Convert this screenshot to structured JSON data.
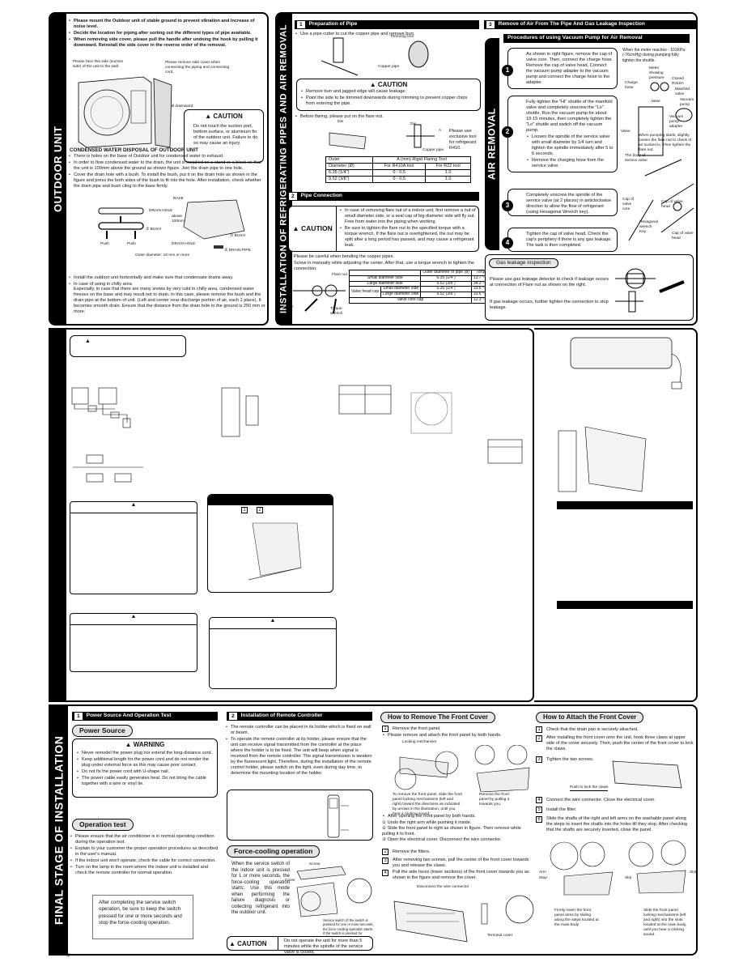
{
  "outdoor": {
    "band": "OUTDOOR UNIT",
    "bullets": [
      "Please mount the Outdoor unit of stable ground to prevent vibration and increase of noise level.",
      "Decide the location for piping after sorting out the different types of pipe available.",
      "When removing side cover, please pull the handle after undoing the hook by pulling it downward. Reinstall the side cover in the reverse order of the removal."
    ],
    "fig_labels": {
      "face": "Please face this side (suction side) of the unit to the wall.",
      "remove": "Please remove side cover when connecting the piping and connecting cord.",
      "pull": "Pull downward"
    },
    "caution": {
      "title": "▲ CAUTION",
      "text": "Do not touch the suction port, bottom surface, or aluminum fin of the outdoor unit. Failure to do so may cause an injury."
    },
    "condensed_title": "CONDENSED WATER DISPOSAL OF OUTDOOR UNIT",
    "condensed_bullets": [
      "There is holes on the base of Outdoor unit for condensed water to exhaust.",
      "In order to flow condensed water to the drain, the unit is installed on a stand or a block so that the unit is 100mm above the ground as shown figure. Join the drain pipe to one hole.",
      "Cover the drain hole with a bush. To install the bush, put it on the drain hole as shown in the figure and press the both sides of the bush to fit into the hole. After installation, check whether the drain pipe and bush cling to the base firmly."
    ],
    "drain_labels": {
      "drain_hole": "DRAIN HOLE",
      "bush": "① BUSH",
      "push1": "Push",
      "push2": "Push",
      "base": "BASE",
      "above": "above 100mm",
      "drain_hole2": "DRAIN HOLE",
      "bush2": "① BUSH",
      "drain_pipe": "② DRAIN PIPE",
      "outer": "Outer diameter: 16 mm or more"
    },
    "final_bullets": [
      "Install the outdoor unit horizontally and make sure that condensate drains away.",
      "In case of using in chilly area"
    ],
    "chilly_text": "Especially, in case that there are many snows by very cold in chilly area, condensed water freezes on the base and may result not to drain. In this case, please remove the bush and the drain pipe at the bottom of unit. (Left and center near discharge portion of air, each 1 place). It becomes smooth drain. Ensure that the distance from the drain hole to the ground is 250 mm or more."
  },
  "install": {
    "band": "INSTALLATION OF REFRIGERATING PIPES AND AIR REMOVAL",
    "s1": {
      "num": "1",
      "title": "Preparation of Pipe",
      "bullet": "Use a pipe cutter to cut the copper pipe and remove burr.",
      "trim": "Trimming tool",
      "copper": "Copper pipe",
      "caution_title": "▲ CAUTION",
      "caution": [
        "Remove burr and jagged edge will cause leakage.",
        "Point the side to be trimmed downwards during trimming to prevent copper chips from entering the pipe."
      ],
      "flare_bullet": "Before flaring, please put on the flare nut.",
      "die1": "Die",
      "die2": "Die",
      "a": "A",
      "copper2": "Copper pipe",
      "note": "Please use exclusive tool for refrigerant R410.",
      "table": {
        "h1": "Outer",
        "h1b": "Diameter (Ø)",
        "h2": "A (mm) Rigid Flaring Tool",
        "h3": "For R410A tool",
        "h4": "For R22 tool",
        "rows": [
          [
            "6.35 (1/4\")",
            "0 - 0.5",
            "1.0"
          ],
          [
            "9.52 (3/8\")",
            "0 - 0.5",
            "1.0"
          ]
        ]
      }
    },
    "s2": {
      "num": "2",
      "title": "Pipe Connection",
      "caution_title": "▲ CAUTION",
      "caution": [
        "In case of removing flare nut of a indoor unit, first remove a nut of small diameter side, or a seal cap of big diameter side will fly out. Free from water into the piping when working.",
        "Be sure to tighten the flare nut to the specified torque with a torque wrench. If the flare nut is overtightened, the nut may be split after a long period has passed, and may cause a refrigerant leak."
      ],
      "bullets": [
        "Please be careful when bending the copper pipes.",
        "Screw in manually while adjusting the center. After that, use a torque wrench to tighten the connection."
      ],
      "flare": "Flare nut",
      "wrench": "Wrench",
      "torque": "Torque wrench",
      "table": {
        "h1": "Outer diameter of pipe (ø)",
        "h2": "Torque N m (kgf-cm)",
        "rows": [
          [
            "Small diameter side",
            "6.35 (1/4\")",
            "13.7 ~ 18.6 (140 ~ 190)"
          ],
          [
            "Large diameter side",
            "9.52 (3/8\")",
            "34.3 ~ 44.1 (350 ~ 450)"
          ]
        ],
        "valve": "Valve head cap",
        "vrows": [
          [
            "Small diameter side",
            "6.35 (1/4\")",
            "19.6 ~ 24.5 (200 ~ 250)"
          ],
          [
            "Large diameter side",
            "9.52 (3/8\")",
            "19.6 ~ 24.5 (200 ~ 250)"
          ]
        ],
        "core": "Valve core cap",
        "core_val": "12.3 ~ 15.7 (125 ~ 160)"
      }
    },
    "s3": {
      "num": "3",
      "title": "Remove of Air From The Pipe And Gas Leakage Inspection",
      "sub": "Procedures of using Vacuum Pump for Air Removal",
      "band": "AIR REMOVAL",
      "steps": [
        "As shown in right figure, remove the cap of valve core. Then, connect the charge hose. Remove the cap of valve head. Connect the vacuum pump adapter to the vacuum pump and connect the charge hose to the adapter.",
        "Fully tighten the \"Hi\" shuttle of the manifold valve and completely unscrew the \"Lo\" shuttle. Run the vacuum pump for about 10-15 minutes, then completely tighten the \"Lo\" shuttle and switch off the vacuum pump.",
        "Completely unscrew the spindle of the service valve (at 2 places) in anticlockwise direction to allow the flow of refrigerant (using Hexagonal Wrench key).",
        "Tighten the cap of valve head. Check the cap's periphery if there is any gas leakage. The task is then completed."
      ],
      "step2_sub": [
        "Loosen the spindle of the service valve with small diameter by 1/4 turn and tighten the spindle immediately after 5 to 6 seconds.",
        "Remove the charging hose from the service valve."
      ],
      "fig": {
        "meter_note": "When the meter reaches - 101KPa (-76cmHg) during pumping fully tighten the shuttle.",
        "meter": "Meter showing pressure",
        "closed": "Closed R410A",
        "manifold": "Manifold valve",
        "charge": "Charge hose",
        "valve": "Valve",
        "vacuum": "Vacuum pump",
        "adapter": "Vacuum pump adapter",
        "valve2": "Valve",
        "pumping": "When pumping starts, slightly loosen the flare nut to check of air sucked in. Then tighten the flare nut.",
        "body": "The body of service valve",
        "capcore": "Cap of valve core",
        "hex": "Hexagonal wrench Key",
        "caphead": "Cap of valve head",
        "caphead2": "Cap of valve head"
      },
      "gas_title": "Gas leakage inspection",
      "gas_p1": "Please use gas leakage detector to check if leakage occurs at connection of Flare nut as shown on the right.",
      "gas_p2": "If gas leakage occurs, further tighten the connection to stop leakage."
    }
  },
  "middle": {
    "caution_icon": "▲",
    "box_numbers": [
      "1",
      "2"
    ]
  },
  "final": {
    "band": "FINAL STAGE OF INSTALLATION",
    "s1": {
      "num": "1",
      "title": "Power Source And Operation Test",
      "power": "Power Source",
      "warning": "▲ WARNING",
      "warn": [
        "Never remodel the power plug nor extend the long-distance cord.",
        "Keep additional length for the power cord and do not render the plug under external force as this may cause poor contact.",
        "Do not fix the power cord with U-shape nail.",
        "The power cable easily generates heat. Do not bring the cable together with a wire or vinyl tie."
      ],
      "optest": "Operation test",
      "op": [
        "Please ensure that the air conditioner is in normal operating condition during the operation test.",
        "Explain to your customer the proper operation procedures as described in the user's manual.",
        "If the indoor unit won't operate, check the cable for correct connection.",
        "Turn on the lamp in the room where the indoor unit is installed and check the remote controller for normal operation."
      ],
      "note": "After completing the service switch operation, be sure to keep the switch pressed for one or more seconds and stop the force-cooling operation."
    },
    "s2": {
      "num": "2",
      "title": "Installation of Remote Controller",
      "bullets": [
        "The remote controller can be placed in its holder which is fixed on wall or beam.",
        "To operate the remote controller at its holder, please ensure that the unit can receive signal transmitted from the controller at the place where the holder is to be fixed. The unit will beep when signal is received from the remote controller. The signal transmission is weaken by the fluorescent light. Therefore, during the installation of the remote control holder, please switch on the light, even during day time, to determine the mounting location of the holder."
      ],
      "force": "Force-cooling operation",
      "force_text": "When the service switch of the indoor unit is pressed for 1 or more seconds, the force-cooling operation starts. Use this mode when performing the failure diagnosis or collecting refrigerant into the outdoor unit.",
      "screw": "Screw",
      "cover": "Cover",
      "switch_note": "Service switch (If the switch is pressed for one or more seconds, the force-cooling operation starts. If the switch is pressed for additional one or more seconds, the operation stops.)",
      "caution_title": "▲ CAUTION",
      "caution": "Do not operate the unit for more than 5 minutes while the spindle of the service valve is closed."
    },
    "remove": {
      "title": "How to Remove The Front Cover",
      "steps": [
        {
          "n": "1",
          "t": "Remove the front panel."
        }
      ],
      "b1": "Please remove and attach the front panel by both hands.",
      "lock": "Locking mechanism",
      "n1": "To remove the front panel, slide the front panel locking mechanisms (left and right) toward the directions as indicated by arrows in the illustration, until you hear a clicking sound.",
      "n2": "Remove the front panel by pulling it towards you.",
      "b2": "After opening the front panel by both hands.",
      "c1": "① Undo the right arm while pushing it inside.",
      "c2": "② Slide the front panel to right as shown in figure. Then remove while pulling it to front.",
      "c3": "③ Open the electrical cover. Disconnect the wire connector.",
      "s2": "Remove the filters.",
      "s3": "After removing two screws, pull the center of the front cover towards you and release the claws.",
      "s4": "Pull the side faces (lower sections) of the front cover towards you as shown in the figure and remove the cover.",
      "disc": "Disconnect the wire connector",
      "term": "Terminal cover"
    },
    "attach": {
      "title": "How to Attach the Front Cover",
      "s1": "Check that the drain pan is securely attached.",
      "s2": "After installing the front cover onto the unit, hook three claws at upper side of the cover securely. Then, push the center of the front cover to lock the claws.",
      "s3": "Tighten the two screws.",
      "push": "Push to lock the claws",
      "s4": "Connect the wire connector. Close the electrical cover.",
      "s5": "Install the filter.",
      "s6": "Slide the shafts of the right and left arms on the washable panel along the steps to insert the shafts into the holes till they stop. After checking that the shafts are securely inserted, close the panel.",
      "arm": "Arm",
      "stop": "Step",
      "slot1": "Slot",
      "slot2": "Slot",
      "n1": "Firmly insert the front panel arms by sliding along the steps located at the main body",
      "n2": "Slide the front panel locking mechanisms (left and right) into the slots located at the main body, until you hear a clicking sound."
    },
    "footer_mark": "®"
  }
}
